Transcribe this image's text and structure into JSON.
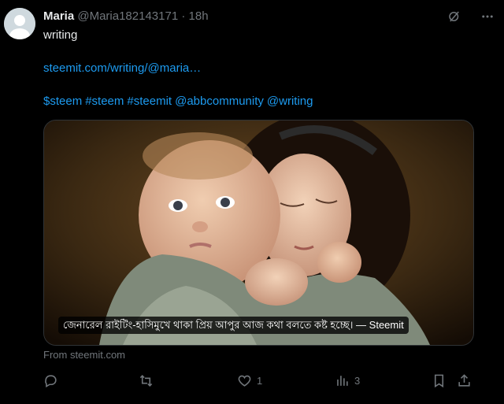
{
  "tweet": {
    "display_name": "Maria",
    "handle": "@Maria182143171",
    "separator": "·",
    "time": "18h",
    "text_line1": "writing",
    "link_text": "steemit.com/writing/@maria…",
    "hashtags": [
      "$steem",
      "#steem",
      "#steemit",
      "@abbcommunity",
      "@writing"
    ],
    "card_caption": "জেনারেল রাইটিং-হাসিমুখে থাকা প্রিয় আপুর আজ কথা বলতে কষ্ট হচ্ছে। — Steemit",
    "from_text": "From steemit.com"
  },
  "actions": {
    "reply_icon": "reply-icon",
    "retweet_icon": "retweet-icon",
    "like_icon": "heart-icon",
    "like_count": "1",
    "views_icon": "views-icon",
    "views_count": "3",
    "bookmark_icon": "bookmark-icon",
    "share_icon": "share-icon"
  },
  "colors": {
    "background": "#000000",
    "text": "#e7e9ea",
    "secondary": "#71767b",
    "link": "#1d9bf0"
  }
}
